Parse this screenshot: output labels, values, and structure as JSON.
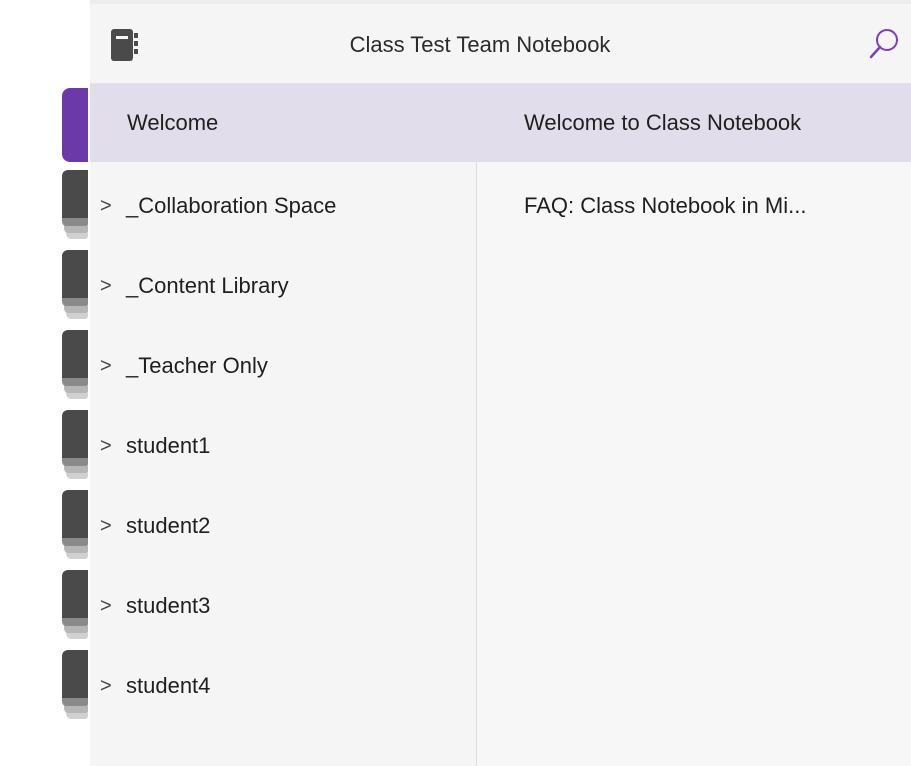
{
  "header": {
    "title": "Class Test Team Notebook",
    "notebook_icon": "notebook-icon",
    "search_icon": "search-icon",
    "accent_color": "#6b3aa8"
  },
  "sections": {
    "selected": "Welcome",
    "items": [
      {
        "label": "Welcome",
        "expandable": false
      },
      {
        "label": "_Collaboration Space",
        "expandable": true
      },
      {
        "label": "_Content Library",
        "expandable": true
      },
      {
        "label": "_Teacher Only",
        "expandable": true
      },
      {
        "label": "student1",
        "expandable": true
      },
      {
        "label": "student2",
        "expandable": true
      },
      {
        "label": "student3",
        "expandable": true
      },
      {
        "label": "student4",
        "expandable": true
      }
    ],
    "chevron": ">"
  },
  "pages": {
    "items": [
      {
        "label": "Welcome to Class Notebook",
        "selected": true
      },
      {
        "label": "FAQ: Class Notebook in Mi...",
        "selected": false
      }
    ]
  },
  "colors": {
    "selection": "#e2ddea",
    "tab_active": "#6b3aa8",
    "tab_inactive": "#4a4a4a"
  }
}
